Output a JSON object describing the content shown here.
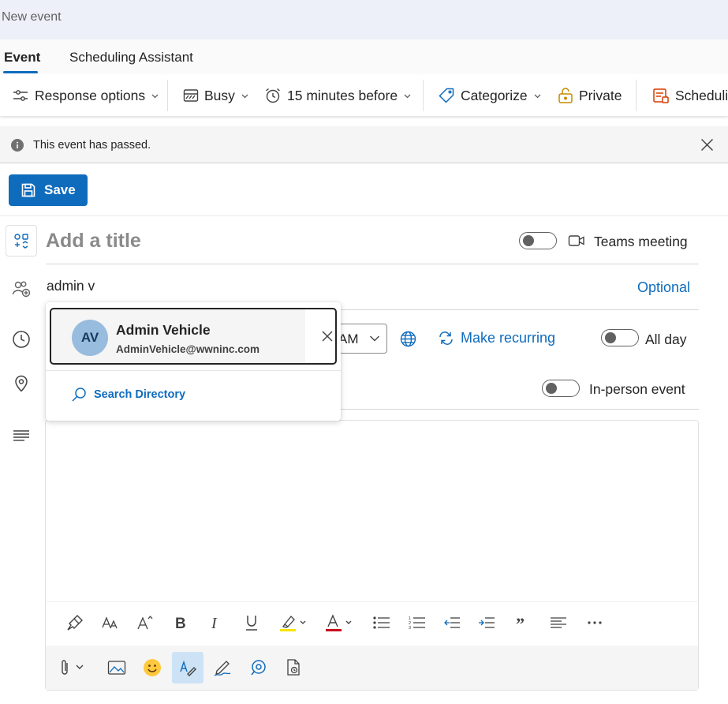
{
  "window": {
    "title": "New event"
  },
  "tabs": [
    {
      "label": "Event",
      "active": true
    },
    {
      "label": "Scheduling Assistant",
      "active": false
    }
  ],
  "ribbon": {
    "response_options": "Response options",
    "show_as": "Busy",
    "reminder": "15 minutes before",
    "categorize": "Categorize",
    "private": "Private",
    "scheduling": "Schedulin"
  },
  "infobar": {
    "message": "This event has passed."
  },
  "toolbar": {
    "save_label": "Save"
  },
  "form": {
    "title_placeholder": "Add a title",
    "teams_meeting_label": "Teams meeting",
    "attendee_input": "admin v",
    "optional_label": "Optional",
    "time_value": "AM",
    "make_recurring": "Make recurring",
    "all_day": "All day",
    "in_person_event": "In-person event"
  },
  "suggestions": {
    "items": [
      {
        "initials": "AV",
        "name": "Admin Vehicle",
        "email": "AdminVehicle@wwninc.com"
      }
    ],
    "search_directory": "Search Directory"
  },
  "colors": {
    "accent": "#0f6cbd",
    "avatar_bg": "#98bcde",
    "title_bar": "#eef0f9"
  },
  "icons": {
    "format_toolbar": [
      "format-painter-icon",
      "font-size-icon",
      "increase-font-icon",
      "bold-icon",
      "italic-icon",
      "underline-icon",
      "highlight-icon",
      "font-color-icon",
      "bullets-icon",
      "numbering-icon",
      "decrease-indent-icon",
      "increase-indent-icon",
      "quote-icon",
      "align-icon",
      "more-icon"
    ],
    "insert_toolbar": [
      "attach-icon",
      "image-icon",
      "emoji-icon",
      "editor-icon",
      "signature-icon",
      "loop-icon",
      "dictate-icon"
    ]
  }
}
